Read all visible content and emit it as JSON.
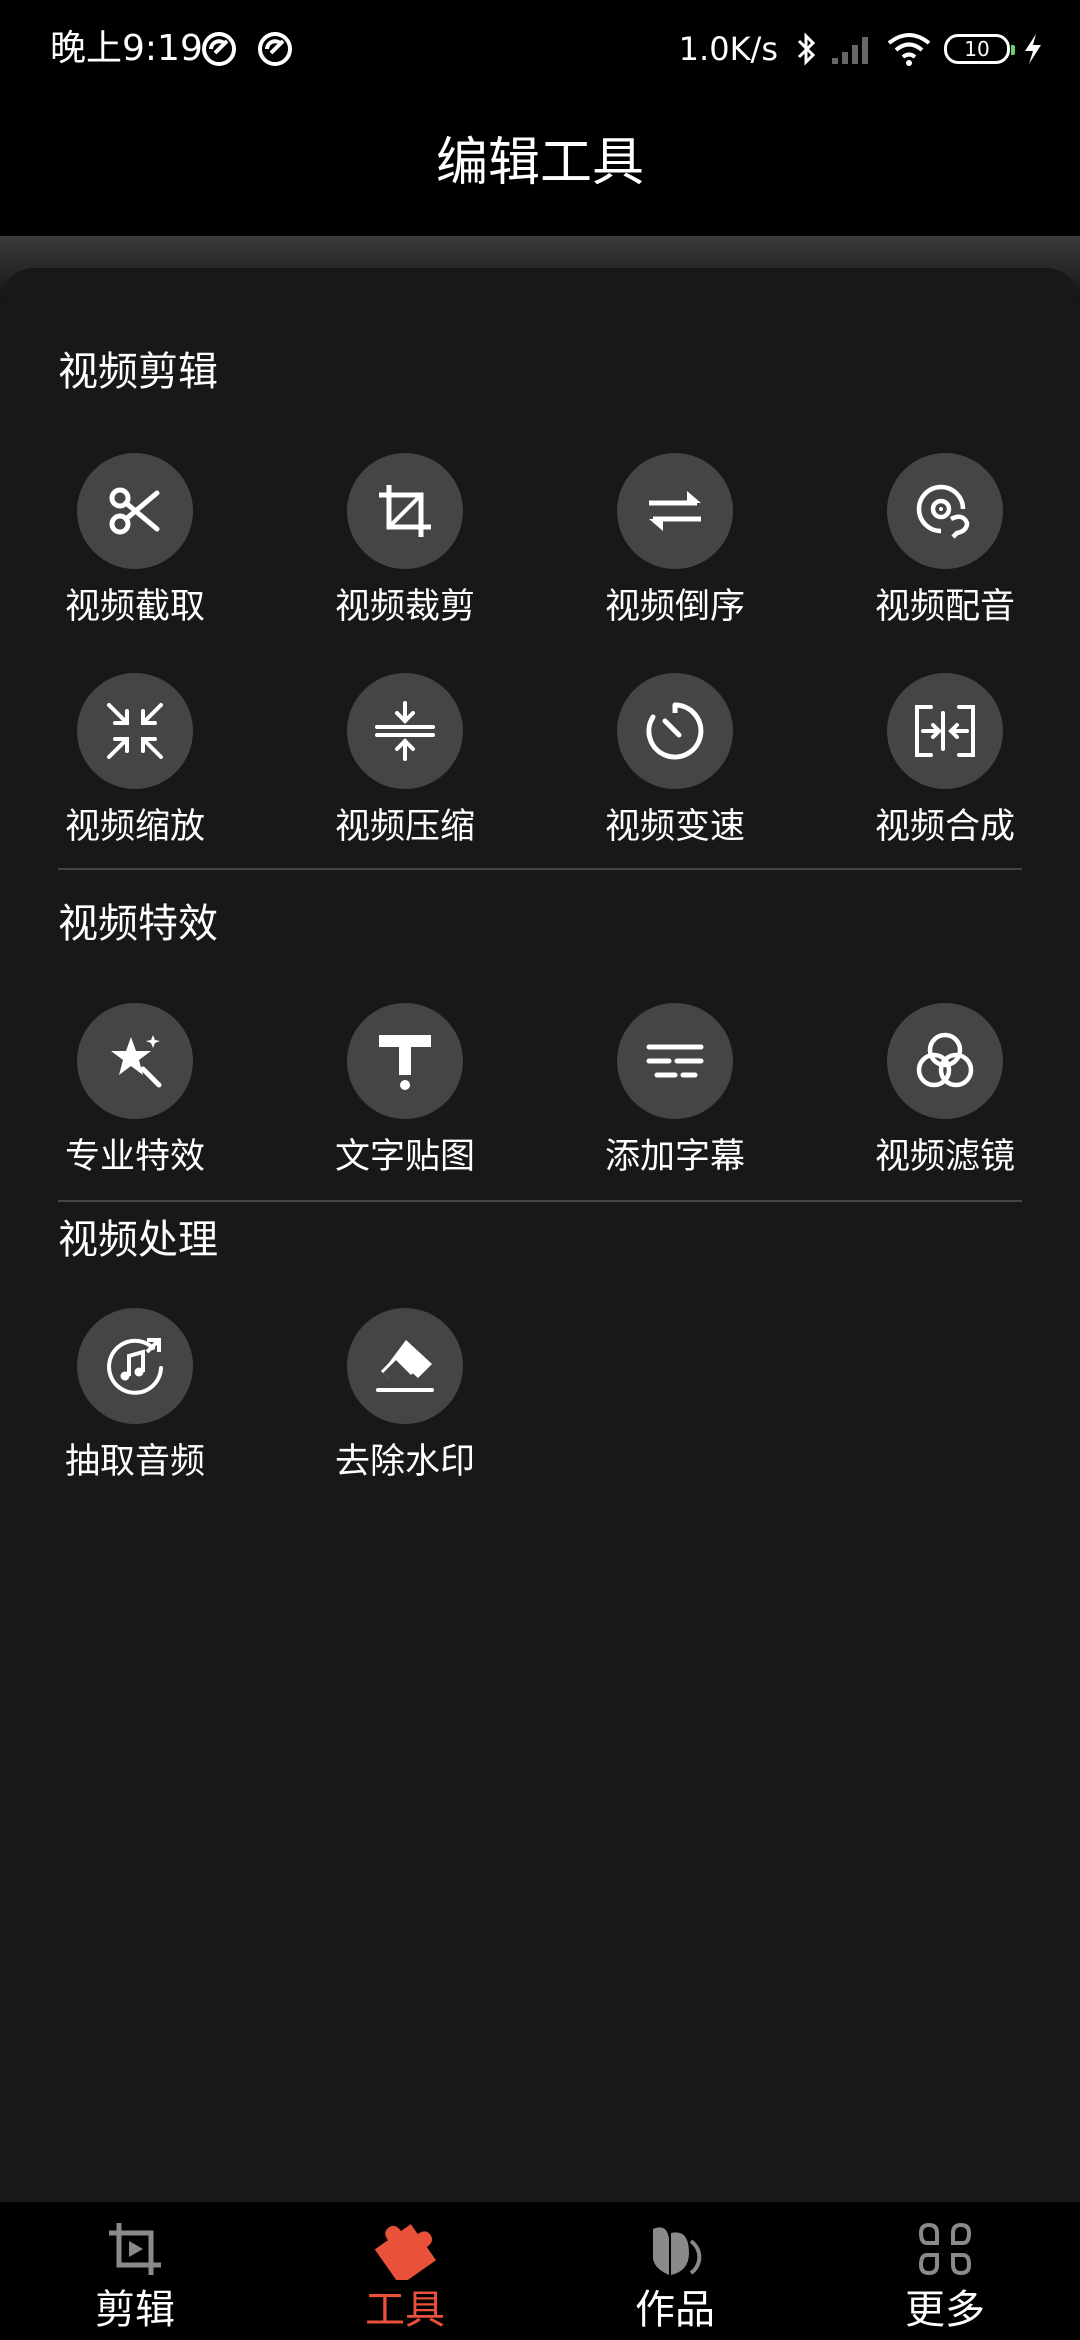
{
  "status_bar": {
    "time": "晚上9:19",
    "net_speed": "1.0K/s",
    "battery": "10"
  },
  "header": {
    "title": "编辑工具"
  },
  "sections": {
    "edit": {
      "title": "视频剪辑",
      "tools": [
        {
          "label": "视频截取",
          "icon": "scissors-icon"
        },
        {
          "label": "视频裁剪",
          "icon": "crop-icon"
        },
        {
          "label": "视频倒序",
          "icon": "swap-arrows-icon"
        },
        {
          "label": "视频配音",
          "icon": "dubbing-icon"
        },
        {
          "label": "视频缩放",
          "icon": "shrink-icon"
        },
        {
          "label": "视频压缩",
          "icon": "compress-icon"
        },
        {
          "label": "视频变速",
          "icon": "speed-dial-icon"
        },
        {
          "label": "视频合成",
          "icon": "merge-icon"
        }
      ]
    },
    "effects": {
      "title": "视频特效",
      "tools": [
        {
          "label": "专业特效",
          "icon": "magic-star-icon"
        },
        {
          "label": "文字贴图",
          "icon": "text-icon"
        },
        {
          "label": "添加字幕",
          "icon": "subtitle-lines-icon"
        },
        {
          "label": "视频滤镜",
          "icon": "filter-circles-icon"
        }
      ]
    },
    "process": {
      "title": "视频处理",
      "tools": [
        {
          "label": "抽取音频",
          "icon": "music-note-icon"
        },
        {
          "label": "去除水印",
          "icon": "eraser-icon"
        }
      ]
    }
  },
  "bottom_nav": {
    "active_color": "#e9513a",
    "items": [
      {
        "label": "剪辑",
        "icon": "crop-play-icon"
      },
      {
        "label": "工具",
        "icon": "puzzle-icon",
        "active": true
      },
      {
        "label": "作品",
        "icon": "works-icon"
      },
      {
        "label": "更多",
        "icon": "more-grid-icon"
      }
    ]
  }
}
